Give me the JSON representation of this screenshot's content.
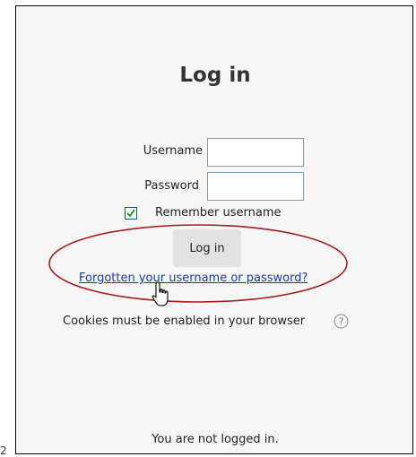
{
  "page": {
    "title": "Log in",
    "stray_mark": "2"
  },
  "form": {
    "username_label": "Username",
    "username_value": "",
    "password_label": "Password",
    "password_value": "",
    "remember_label": "Remember username",
    "remember_checked": true,
    "login_button": "Log in",
    "forgot_link": "Forgotten your username or password?"
  },
  "notes": {
    "cookies": "Cookies must be enabled in your browser",
    "help_icon": "help-question-icon"
  },
  "footer": {
    "login_status": "You are not logged in."
  },
  "annotation": {
    "ellipse_color": "#a31d1d",
    "cursor_icon": "hand-pointer-cursor-icon"
  }
}
